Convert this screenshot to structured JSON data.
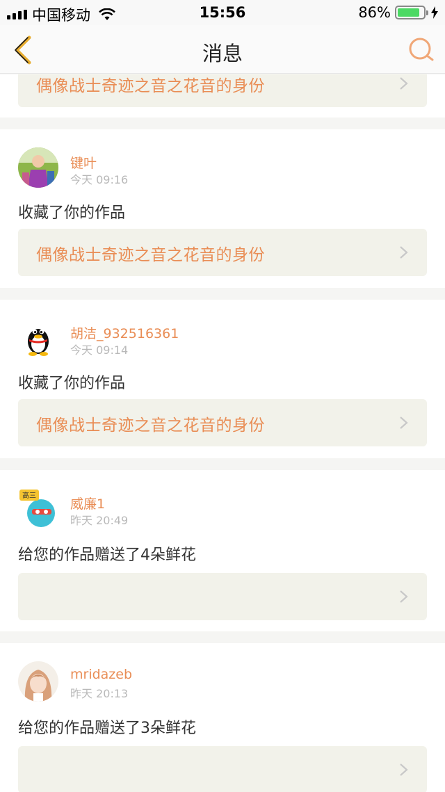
{
  "status_bar": {
    "carrier": "中国移动",
    "time": "15:56",
    "battery": "86%",
    "battery_level": 0.86
  },
  "nav": {
    "title": "消息",
    "back_icon": "chevron-left-icon",
    "search_icon": "search-icon",
    "accent": "#e98d55"
  },
  "top_partial_card": {
    "work_title": "偶像战士奇迹之音之花音的身份"
  },
  "messages": [
    {
      "user": "键叶",
      "time": "今天 09:16",
      "action": "收藏了你的作品",
      "work_title": "偶像战士奇迹之音之花音的身份"
    },
    {
      "user": "胡洁_932516361",
      "time": "今天 09:14",
      "action": "收藏了你的作品",
      "work_title": "偶像战士奇迹之音之花音的身份"
    },
    {
      "user": "威廉1",
      "time": "昨天 20:49",
      "action": "给您的作品赠送了4朵鲜花",
      "work_title": ""
    },
    {
      "user": "mridazeb",
      "time": "昨天 20:13",
      "action": "给您的作品赠送了3朵鲜花",
      "work_title": ""
    }
  ],
  "avatar_badge_text": "高三"
}
